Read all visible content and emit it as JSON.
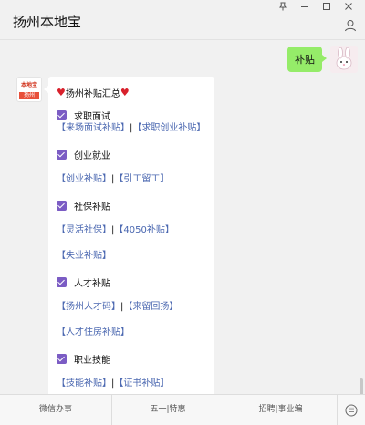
{
  "window": {
    "title": "扬州本地宝",
    "controls": [
      "pin-icon",
      "minimize-icon",
      "maximize-icon",
      "close-icon"
    ]
  },
  "chat": {
    "outgoing": {
      "text": "补贴"
    },
    "incoming": {
      "avatar_text_top": "本地宝",
      "avatar_text_bottom": "扬州",
      "heading": "扬州补贴汇总",
      "sections": [
        {
          "title": "求职面试",
          "links": [
            [
              "【来场面试补贴】",
              "|",
              "【求职创业补贴】"
            ]
          ]
        },
        {
          "title": "创业就业",
          "links": [
            [
              "【创业补贴】",
              "|",
              "【引工留工】"
            ]
          ]
        },
        {
          "title": "社保补贴",
          "links": [
            [
              "【灵活社保】",
              "|",
              "【4050补贴】"
            ],
            [
              "【失业补贴】"
            ]
          ]
        },
        {
          "title": "人才补贴",
          "links": [
            [
              "【扬州人才码】",
              "|",
              "【来留回扬】"
            ],
            [
              "【人才住房补贴】"
            ]
          ]
        },
        {
          "title": "职业技能",
          "links": [
            [
              "【技能补贴】",
              "|",
              "【证书补贴】"
            ]
          ]
        }
      ]
    }
  },
  "menu": {
    "items": [
      "微信办事",
      "五一|特惠",
      "招聘|事业编"
    ],
    "keyboard_icon": "keyboard-icon"
  }
}
